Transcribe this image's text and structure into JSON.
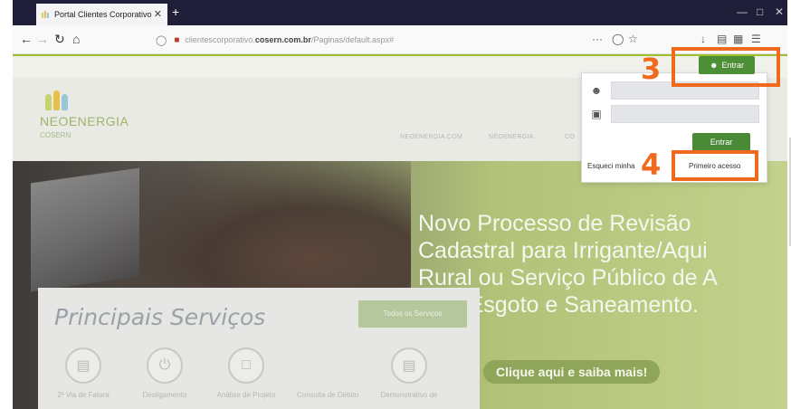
{
  "browser": {
    "tab_title": "Portal Clientes Corporativo",
    "tab_close": "✕",
    "new_tab": "+",
    "url_prefix": "clientescorporativo.",
    "url_host": "cosern.com.br",
    "url_path": "/Paginas/default.aspx#",
    "url_more": "···",
    "window_controls": [
      "—",
      "□",
      "✕"
    ]
  },
  "site": {
    "brand": "NEOENERGIA",
    "sub_brand": "COSERN",
    "logo_colors": [
      "#c7d36f",
      "#e6c04c",
      "#9ac7d8"
    ],
    "nav_items": [
      "NEOENERGIA.COM",
      "NEOENERGIA",
      "CO"
    ],
    "hero_title_lines": [
      "Novo Processo de Revisão",
      "Cadastral para Irrigante/Aqui",
      "Rural ou Serviço Público de A",
      "gua, Esgoto e Saneamento."
    ],
    "hero_cta": "Clique aqui e saiba mais!",
    "services_title": "Principais Serviços",
    "services_button": "Todos os Serviços",
    "services": [
      {
        "label": "2ª Via de Fatura",
        "icon": "invoice-icon"
      },
      {
        "label": "Desligamento",
        "icon": "power-icon"
      },
      {
        "label": "Análise de Projeto",
        "icon": "monitor-icon"
      },
      {
        "label": "Consulta de Débito",
        "icon": "search-icon"
      },
      {
        "label": "Demonstrativo de",
        "icon": "document-icon"
      }
    ]
  },
  "login": {
    "top_button": "Entrar",
    "submit": "Entrar",
    "forgot": "Esqueci minha",
    "first_access": "Primeiro acesso"
  },
  "annotations": {
    "step3": "3",
    "step4": "4",
    "color": "#ef6a1c"
  }
}
